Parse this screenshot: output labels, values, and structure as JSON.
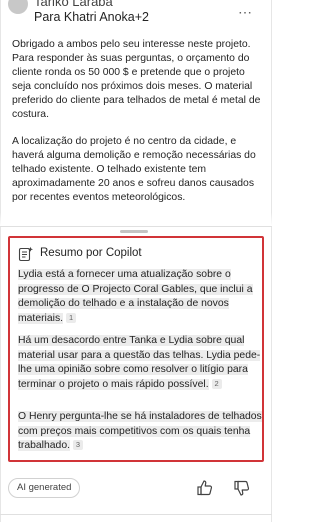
{
  "email": {
    "sender": "Tariko Laraba",
    "recipients": "Para Khatri Anoka+2",
    "body_paragraphs": [
      "Obrigado a ambos pelo seu interesse neste projeto. Para responder às suas perguntas, o orçamento do cliente ronda os 50 000 $ e pretende que o projeto seja concluído nos próximos dois meses. O material preferido do cliente para telhados de metal é metal de costura.",
      "A localização do projeto é no centro da cidade, e haverá alguma demolição e remoção necessárias do telhado existente. O telhado existente tem aproximadamente 20 anos e sofreu danos causados por recentes eventos meteorológicos."
    ]
  },
  "copilot": {
    "title": "Resumo por Copilot",
    "summary": [
      {
        "text": "Lydia está a fornecer uma atualização sobre o progresso de O Projecto Coral Gables, que inclui a demolição do telhado e a instalação de novos materiais.",
        "ref": "1"
      },
      {
        "text": "Há um desacordo entre Tanka e Lydia sobre qual material usar para a questão das telhas. Lydia pede-lhe uma opinião sobre como resolver o litígio para terminar o projeto o mais rápido possível.",
        "ref": "2"
      },
      {
        "text": "O Henry pergunta-lhe se há instaladores de telhados com preços mais competitivos com os quais tenha trabalhado.",
        "ref": "3"
      }
    ]
  },
  "footer": {
    "ai_label": "AI generated"
  },
  "icons": {
    "more": "more-horizontal-icon",
    "copilot": "copilot-summary-icon",
    "thumbs_up": "thumbs-up-icon",
    "thumbs_down": "thumbs-down-icon"
  },
  "colors": {
    "highlight_border": "#d13438",
    "text": "#242424",
    "muted": "#616161"
  }
}
